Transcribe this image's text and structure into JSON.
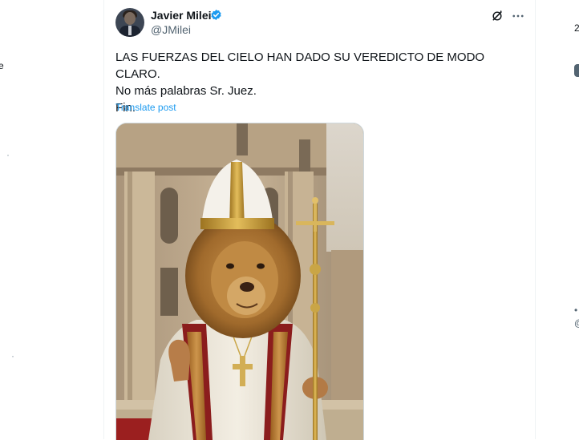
{
  "left_fragments": {
    "a": "e",
    "b": "·",
    "c": "·"
  },
  "right_fragments": {
    "a": "2",
    "b": "@",
    "c": "•"
  },
  "tweet": {
    "author_name": "Javier Milei",
    "handle": "@JMilei",
    "verified_color": "#1d9bf0",
    "text_lines": [
      "LAS FUERZAS DEL CIELO HAN DADO SU VEREDICTO DE MODO CLARO.",
      "No más palabras Sr. Juez.",
      "Fin."
    ],
    "translate_label": "Translate post",
    "icons": [
      "grok-icon",
      "more-icon",
      "verified-badge-icon"
    ],
    "media_icon": "lion-pope-image"
  },
  "colors": {
    "accent": "#1d9bf0",
    "text": "#0f1419",
    "secondary": "#536471",
    "border": "#eff3f4"
  }
}
